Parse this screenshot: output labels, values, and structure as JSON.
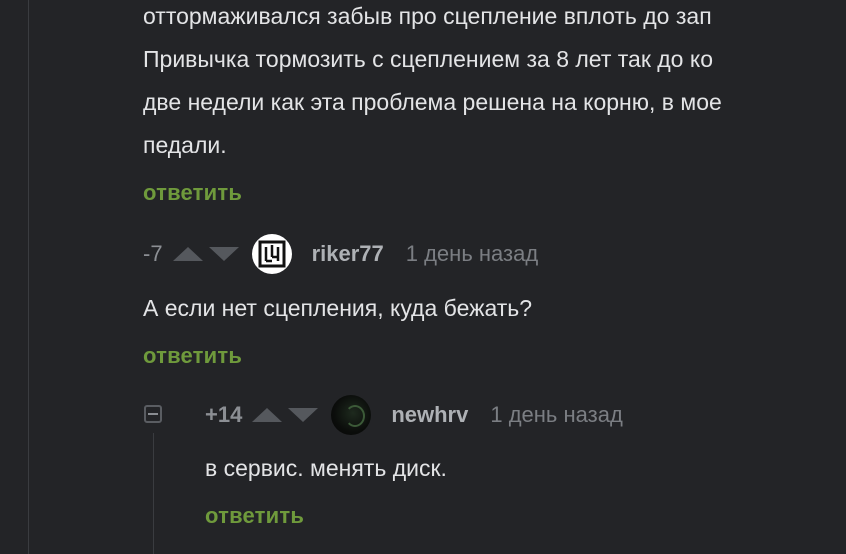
{
  "comment1": {
    "lines": [
      "оттормаживался забыв про сцепление вплоть до зап",
      "Привычка тормозить с сцеплением за 8 лет так до ко",
      "две недели как эта проблема решена на корню, в мое",
      "педали."
    ],
    "reply_label": "ответить"
  },
  "comment2": {
    "rating": "-7",
    "username": "riker77",
    "time": "1 день назад",
    "text": "А если нет сцепления, куда бежать?",
    "reply_label": "ответить",
    "avatar_icon": "rammstein-logo-icon"
  },
  "comment3": {
    "rating": "+14",
    "username": "newhrv",
    "time": "1 день назад",
    "text": "в сервис. менять диск.",
    "reply_label": "ответить",
    "avatar_icon": "dark-avatar-icon"
  },
  "colors": {
    "background": "#232427",
    "reply_green": "#6f9a3c",
    "text": "#e3e4e6",
    "muted": "#7b7e83"
  }
}
